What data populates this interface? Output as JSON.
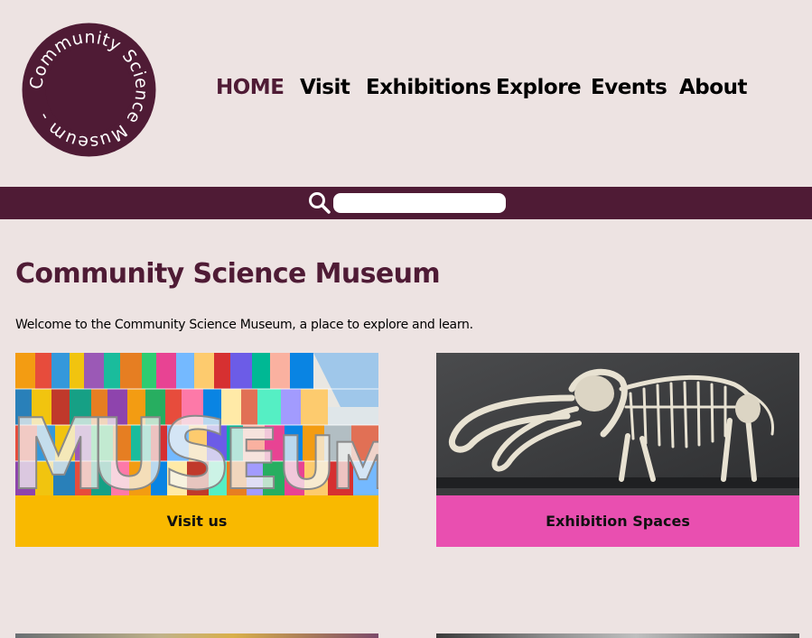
{
  "logo": {
    "text": "Community Science Museum - ",
    "color": "#4f1b35"
  },
  "nav": {
    "items": [
      {
        "label": "HOME",
        "active": true
      },
      {
        "label": "Visit"
      },
      {
        "label": "Exhibitions"
      },
      {
        "label": "Explore"
      },
      {
        "label": "Events"
      },
      {
        "label": "About"
      }
    ]
  },
  "search": {
    "value": "",
    "placeholder": "",
    "icon": "search-icon",
    "bar_color": "#4f1b35"
  },
  "main": {
    "title": "Community Science Museum",
    "intro": "Welcome to the Community Science Museum, a place to explore and learn.",
    "cards": [
      {
        "label": "Visit us",
        "color": "#f9b900",
        "image": "museum-sign-image"
      },
      {
        "label": "Exhibition Spaces",
        "color": "#e94fb0",
        "image": "mammoth-skeleton-image"
      }
    ]
  },
  "colors": {
    "background": "#ede3e2",
    "brand": "#4f1b35"
  }
}
